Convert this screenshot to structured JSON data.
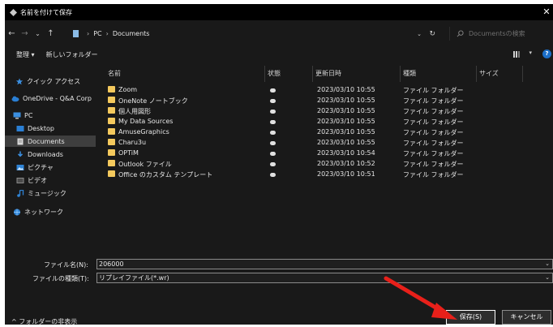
{
  "window": {
    "title": "名前を付けて保存",
    "close_glyph": "✕"
  },
  "nav": {
    "back": "←",
    "forward": "→",
    "recent": "⌄",
    "up": "↑"
  },
  "address": {
    "crumbs": [
      "PC",
      "Documents"
    ],
    "separator": "›",
    "dropdown": "⌄",
    "refresh": "↻"
  },
  "search": {
    "placeholder": "Documentsの検索"
  },
  "toolbar": {
    "organize": "整理 ▾",
    "new_folder": "新しいフォルダー",
    "view_dropdown": "▾",
    "help": "?"
  },
  "sidebar": {
    "items": [
      {
        "label": "クイック アクセス",
        "icon": "star-icon"
      },
      {
        "label": "OneDrive - Q&A Corp",
        "icon": "cloud-icon"
      },
      {
        "label": "PC",
        "icon": "computer-icon"
      },
      {
        "label": "Desktop",
        "icon": "desktop-icon"
      },
      {
        "label": "Documents",
        "icon": "document-icon"
      },
      {
        "label": "Downloads",
        "icon": "download-icon"
      },
      {
        "label": "ピクチャ",
        "icon": "picture-icon"
      },
      {
        "label": "ビデオ",
        "icon": "video-icon"
      },
      {
        "label": "ミュージック",
        "icon": "music-icon"
      },
      {
        "label": "ネットワーク",
        "icon": "network-icon"
      }
    ]
  },
  "columns": {
    "name": "名前",
    "status": "状態",
    "date": "更新日時",
    "type": "種類",
    "size": "サイズ"
  },
  "files": [
    {
      "name": "Zoom",
      "date": "2023/03/10 10:55",
      "type": "ファイル フォルダー"
    },
    {
      "name": "OneNote ノートブック",
      "date": "2023/03/10 10:55",
      "type": "ファイル フォルダー"
    },
    {
      "name": "個人用図形",
      "date": "2023/03/10 10:55",
      "type": "ファイル フォルダー"
    },
    {
      "name": "My Data Sources",
      "date": "2023/03/10 10:55",
      "type": "ファイル フォルダー"
    },
    {
      "name": "AmuseGraphics",
      "date": "2023/03/10 10:55",
      "type": "ファイル フォルダー"
    },
    {
      "name": "Charu3u",
      "date": "2023/03/10 10:55",
      "type": "ファイル フォルダー"
    },
    {
      "name": "OPTiM",
      "date": "2023/03/10 10:54",
      "type": "ファイル フォルダー"
    },
    {
      "name": "Outlook ファイル",
      "date": "2023/03/10 10:52",
      "type": "ファイル フォルダー"
    },
    {
      "name": "Office のカスタム テンプレート",
      "date": "2023/03/10 10:51",
      "type": "ファイル フォルダー"
    }
  ],
  "form": {
    "filename_label": "ファイル名(N):",
    "filename_value": "206000",
    "filetype_label": "ファイルの種類(T):",
    "filetype_value": "リプレイファイル(*.wr)",
    "chevron": "⌄"
  },
  "footer": {
    "hide_folders": "^ フォルダーの非表示",
    "save": "保存(S)",
    "cancel": "キャンセル"
  },
  "colors": {
    "accent": "#1c6fc9",
    "folder": "#f4c95d",
    "arrow": "#e8201a"
  }
}
